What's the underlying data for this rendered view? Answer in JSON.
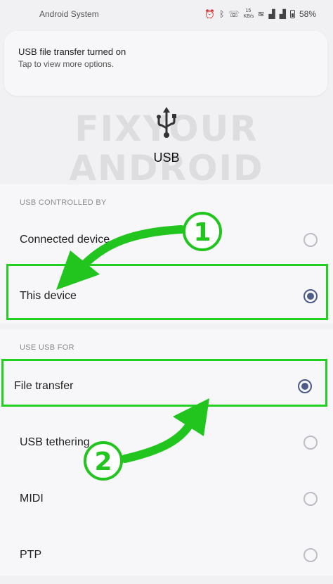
{
  "status_bar": {
    "app_name": "Android System",
    "speed_top": "15",
    "speed_unit": "KB/s",
    "battery": "58%"
  },
  "notification": {
    "title": "USB file transfer turned on",
    "subtitle": "Tap to view more options."
  },
  "watermark": {
    "line1": "FIXYOUR",
    "line2": "ANDROID"
  },
  "usb_header": {
    "icon": "usb-icon",
    "title": "USB"
  },
  "controlled_by": {
    "label": "USB CONTROLLED BY",
    "options": [
      {
        "label": "Connected device",
        "selected": false
      },
      {
        "label": "This device",
        "selected": true
      }
    ]
  },
  "use_usb_for": {
    "label": "USE USB FOR",
    "options": [
      {
        "label": "File transfer",
        "selected": true
      },
      {
        "label": "USB tethering",
        "selected": false
      },
      {
        "label": "MIDI",
        "selected": false
      },
      {
        "label": "PTP",
        "selected": false
      }
    ]
  },
  "annotations": {
    "step1": "1",
    "step2": "2",
    "highlight_color": "#21d021",
    "arrow_color": "#22c51e"
  },
  "colors": {
    "radio_selected": "#4d5b86",
    "radio_unselected": "#bcbcc4"
  }
}
